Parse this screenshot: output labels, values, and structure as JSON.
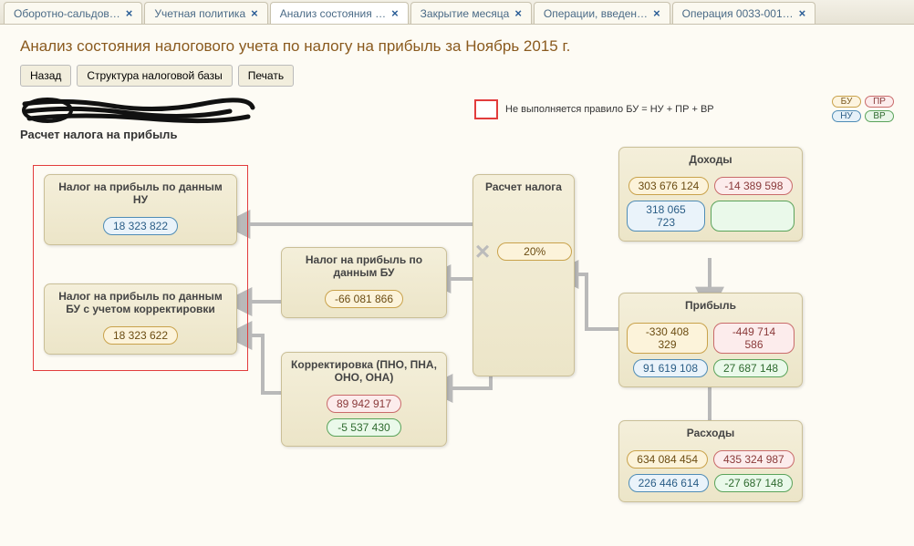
{
  "tabs": [
    {
      "label": "Оборотно-сальдов…",
      "active": false
    },
    {
      "label": "Учетная политика",
      "active": false
    },
    {
      "label": "Анализ состояния …",
      "active": true
    },
    {
      "label": "Закрытие месяца",
      "active": false
    },
    {
      "label": "Операции, введен…",
      "active": false
    },
    {
      "label": "Операция 0033-001…",
      "active": false
    }
  ],
  "title": "Анализ состояния налогового учета по налогу на прибыль за Ноябрь 2015 г.",
  "toolbar": {
    "back": "Назад",
    "structure": "Структура налоговой базы",
    "print": "Печать"
  },
  "legend": {
    "rule": "Не выполняется правило БУ = НУ + ПР + ВР",
    "pills": {
      "bu": "БУ",
      "nu": "НУ",
      "pr": "ПР",
      "vr": "ВР"
    }
  },
  "subtitle": "Расчет налога на прибыль",
  "cards": {
    "calc": {
      "title": "Расчет налога",
      "rate": "20%"
    },
    "nu": {
      "title": "Налог на прибыль по данным НУ",
      "value": "18 323 822"
    },
    "bu": {
      "title": "Налог на прибыль по данным БУ",
      "value": "-66 081 866"
    },
    "bu_corr": {
      "title": "Налог на прибыль по данным БУ с учетом корректировки",
      "value": "18 323 622"
    },
    "corr": {
      "title": "Корректировка (ПНО, ПНА, ОНО, ОНА)",
      "pr": "89 942 917",
      "vr": "-5 537 430"
    },
    "income": {
      "title": "Доходы",
      "bu": "303 676 124",
      "pr": "-14 389 598",
      "nu": "318 065 723",
      "vr": ""
    },
    "profit": {
      "title": "Прибыль",
      "bu": "-330 408 329",
      "pr": "-449 714 586",
      "nu": "91 619 108",
      "vr": "27 687 148"
    },
    "expense": {
      "title": "Расходы",
      "bu": "634 084 454",
      "pr": "435 324 987",
      "nu": "226 446 614",
      "vr": "-27 687 148"
    }
  }
}
